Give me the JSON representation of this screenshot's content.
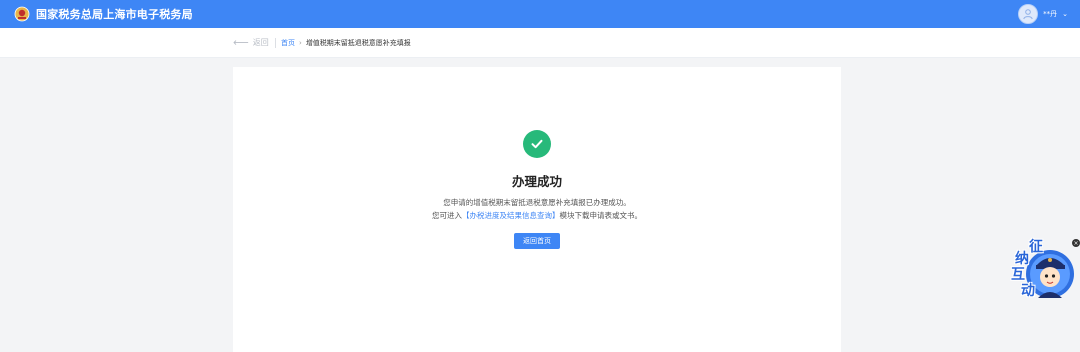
{
  "header": {
    "title": "国家税务总局上海市电子税务局",
    "username": "**丹",
    "chevron": "⌄",
    "bg_color": "#3e86f5"
  },
  "breadcrumb": {
    "back_label": "返回",
    "home": "首页",
    "separator": "›",
    "current": "增值税期末留抵退税意愿补充填报"
  },
  "result": {
    "title": "办理成功",
    "message_line1": "您申请的增值税期末留抵退税意愿补充填报已办理成功。",
    "message_line2_prefix": "您可进入",
    "message_line2_link": "【办税进度及结果信息查询】",
    "message_line2_suffix": "模块下载申请表或文书。",
    "button_label": "返回首页",
    "success_color": "#27b97a"
  },
  "widget": {
    "chars": [
      "征",
      "纳",
      "互",
      "动"
    ],
    "close_symbol": "×"
  }
}
